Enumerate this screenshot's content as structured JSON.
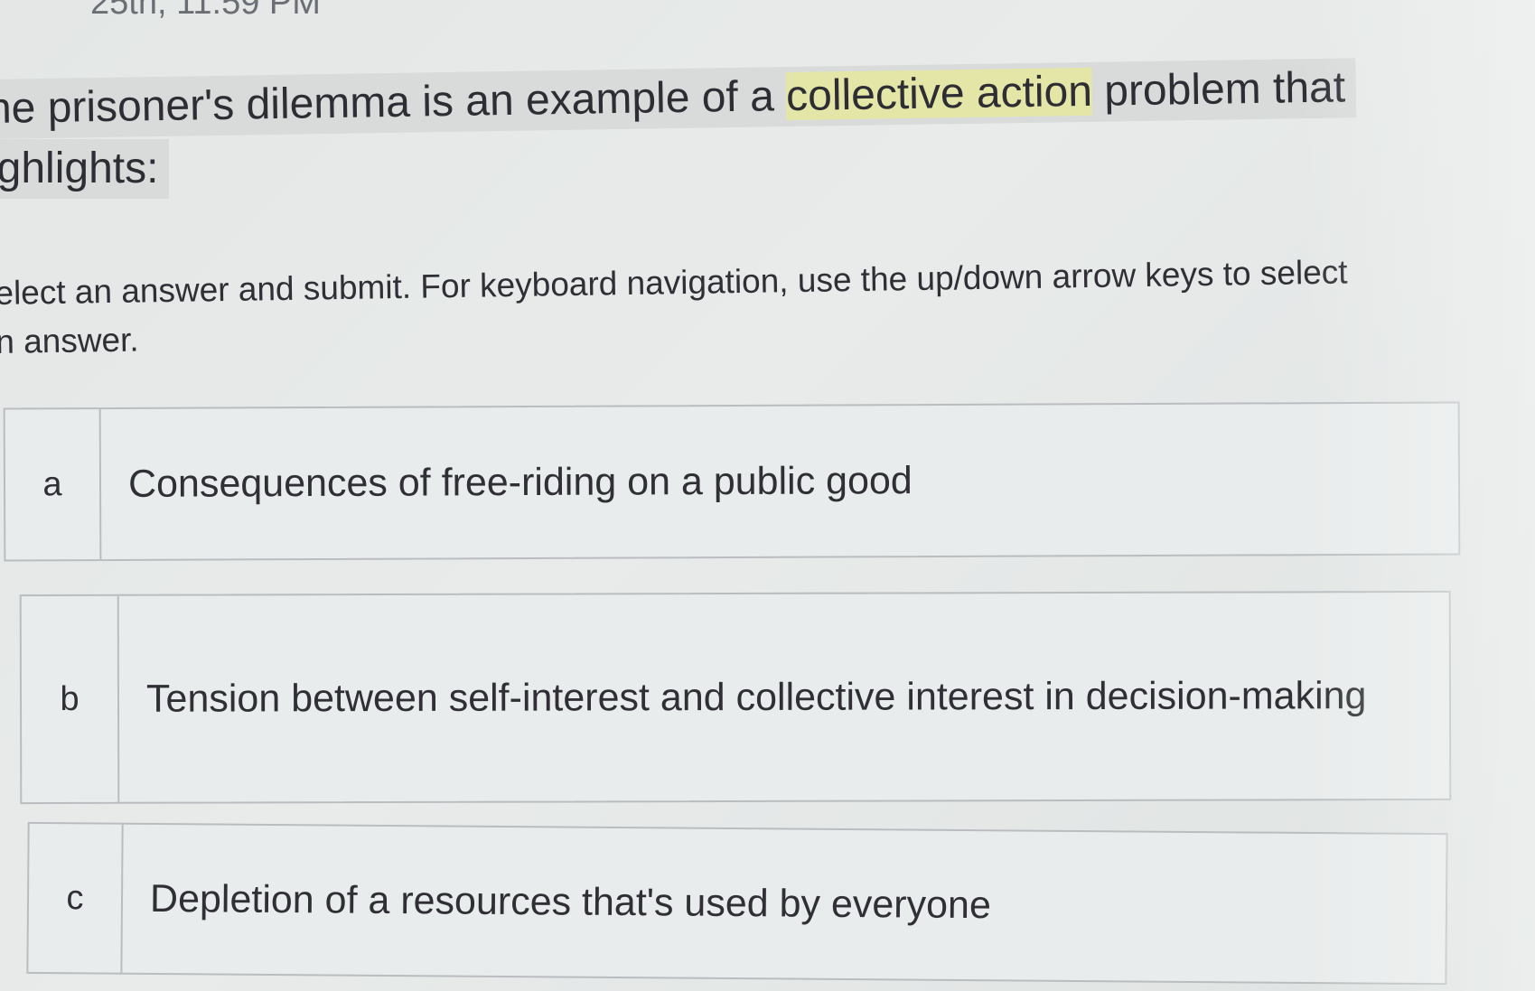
{
  "header": {
    "due_date": "25th, 11:59 PM"
  },
  "question": {
    "line1_before": "he prisoner's dilemma is an example of a ",
    "line1_highlight": "collective action",
    "line1_after": " problem that",
    "line2": "ighlights:"
  },
  "instructions": {
    "line1": "elect an answer and submit. For keyboard navigation, use the up/down arrow keys to select",
    "line2": "n answer."
  },
  "options": [
    {
      "letter": "a",
      "text": "Consequences of free-riding on a public good"
    },
    {
      "letter": "b",
      "text": "Tension between self-interest and collective interest in decision-making"
    },
    {
      "letter": "c",
      "text": "Depletion of a resources that's used by everyone"
    }
  ],
  "colors": {
    "highlight": "#e3e6a6",
    "question_background": "#d9dbdb",
    "border": "#b9bdbf"
  }
}
